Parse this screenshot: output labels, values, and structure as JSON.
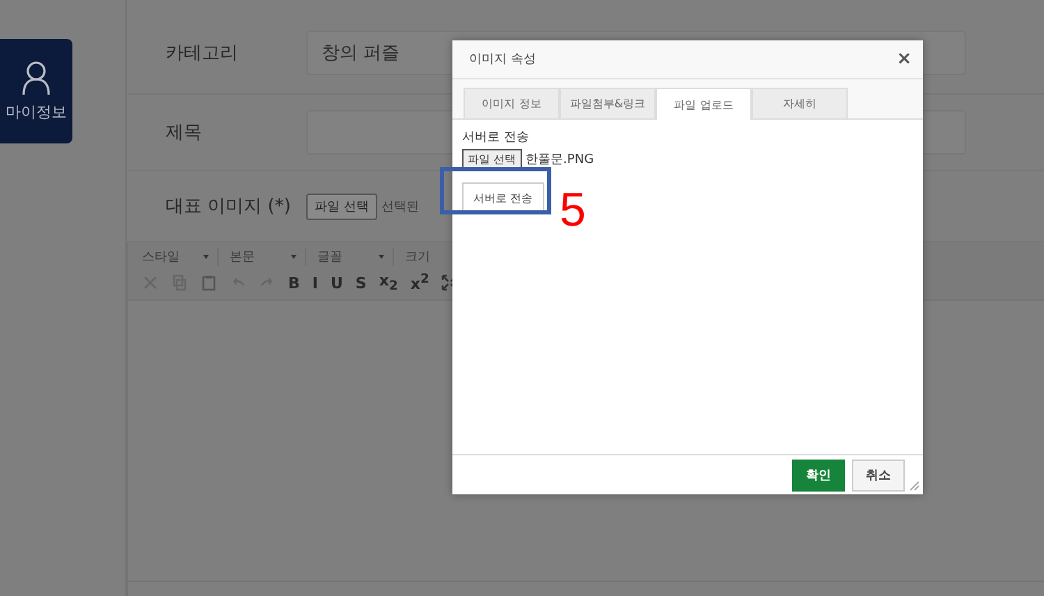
{
  "sidebar": {
    "items": [
      {
        "label": "마이정보"
      }
    ]
  },
  "form": {
    "rows": [
      {
        "kind": "select",
        "label": "카테고리",
        "value": "창의 퍼즐"
      },
      {
        "kind": "text",
        "label": "제목"
      },
      {
        "kind": "file",
        "label": "대표 이미지 (*)",
        "button": "파일 선택",
        "file_name": "선택된"
      }
    ]
  },
  "editor": {
    "dropdowns": [
      "스타일",
      "본문",
      "글꼴",
      "크기"
    ],
    "format_buttons": [
      "B",
      "I",
      "U",
      "S",
      "x$_{2}$",
      "x$^{2}$"
    ]
  },
  "dialog": {
    "title": "이미지 속성",
    "close": "×",
    "tabs": [
      {
        "label": "이미지 정보",
        "selected": false
      },
      {
        "label": "파일첨부&링크",
        "selected": false
      },
      {
        "label": "파일 업로드",
        "selected": true
      },
      {
        "label": "자세히",
        "selected": false
      }
    ],
    "upload": {
      "label": "서버로 전송",
      "file_button": "파일 선택",
      "file_name": "한풀문.PNG",
      "send_button": "서버로 전송"
    },
    "buttons": [
      {
        "label": "확인",
        "kind": "primary"
      },
      {
        "label": "취소",
        "kind": "secondary"
      }
    ]
  },
  "annotation": {
    "number": "5"
  }
}
